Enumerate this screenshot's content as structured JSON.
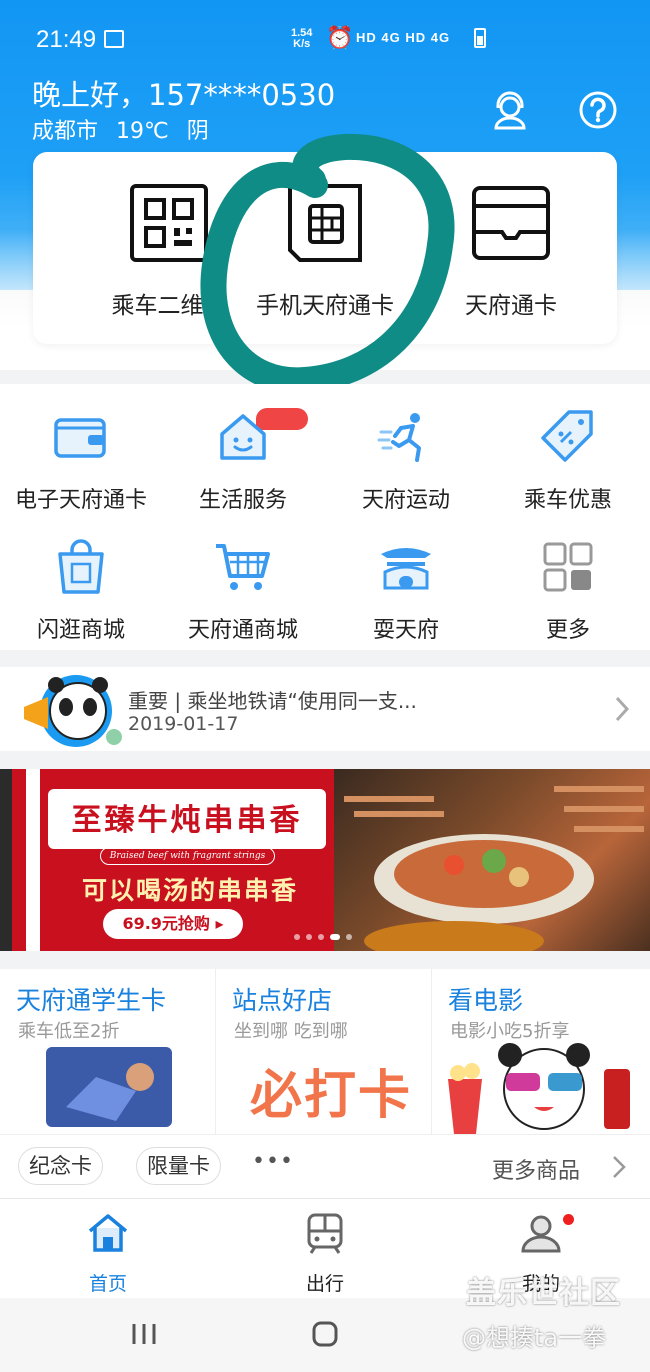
{
  "status_bar": {
    "time": "21:49",
    "speed_value": "1.54",
    "speed_unit": "K/s",
    "network": "HD 4G HD 4G"
  },
  "header": {
    "greeting": "晚上好，157****0530",
    "city": "成都市",
    "temperature": "19℃",
    "weather": "阴"
  },
  "quick_actions": [
    {
      "label": "乘车二维码",
      "icon": "qr-code-icon"
    },
    {
      "label": "手机天府通卡",
      "icon": "sim-card-icon"
    },
    {
      "label": "天府通卡",
      "icon": "transit-card-icon"
    }
  ],
  "menu_row1": [
    {
      "label": "电子天府通卡",
      "icon": "wallet-icon"
    },
    {
      "label": "生活服务",
      "icon": "home-service-icon"
    },
    {
      "label": "天府运动",
      "icon": "running-icon"
    },
    {
      "label": "乘车优惠",
      "icon": "discount-tag-icon"
    }
  ],
  "menu_row2": [
    {
      "label": "闪逛商城",
      "icon": "shopping-bag-icon"
    },
    {
      "label": "天府通商城",
      "icon": "cart-icon"
    },
    {
      "label": "耍天府",
      "icon": "pavilion-icon"
    },
    {
      "label": "更多",
      "icon": "grid-more-icon"
    }
  ],
  "notice": {
    "text": "重要 | 乘坐地铁请“使用同一支...",
    "date": "2019-01-17"
  },
  "banner": {
    "title": "至臻牛炖串串香",
    "subtitle": "Braised beef with fragrant strings",
    "slogan": "可以喝汤的串串香",
    "button": "69.9元抢购 ▸"
  },
  "tiles": [
    {
      "title": "天府通学生卡",
      "subtitle": "乘车低至2折"
    },
    {
      "title": "站点好店",
      "subtitle": "坐到哪 吃到哪",
      "art_text": "必打卡"
    },
    {
      "title": "看电影",
      "subtitle": "电影小吃5折享"
    }
  ],
  "tags": [
    "纪念卡",
    "限量卡"
  ],
  "tags_more": "•••",
  "more_goods": "更多商品",
  "tabbar": [
    {
      "label": "首页",
      "icon": "home-icon",
      "active": true
    },
    {
      "label": "出行",
      "icon": "train-icon",
      "active": false
    },
    {
      "label": "我的",
      "icon": "profile-icon",
      "active": false
    }
  ],
  "watermark": {
    "line1": "盖乐世社区",
    "line2": "@想揍ta一拳"
  },
  "colors": {
    "brand_blue": "#1296f4",
    "accent_text": "#1a82de",
    "banner_red": "#c8101f",
    "annotation_teal": "#0f8c86"
  }
}
